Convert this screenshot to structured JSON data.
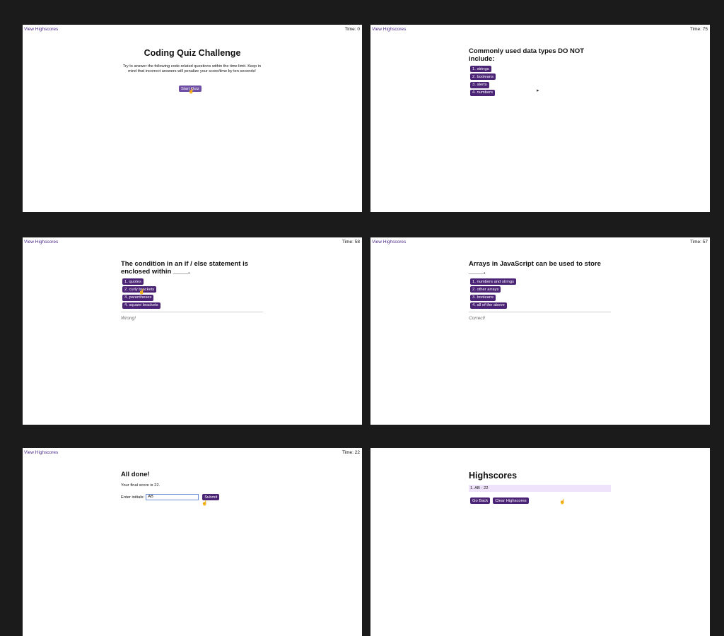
{
  "header": {
    "view_highscores": "View Highscores"
  },
  "screen1": {
    "timer": "Time: 0",
    "title": "Coding Quiz Challenge",
    "description": "Try to answer the following code-related questions within the time limit. Keep in mind that incorrect answers will penalize your score/time by ten seconds!",
    "start_button": "Start Quiz"
  },
  "screen2": {
    "timer": "Time: 75",
    "question": "Commonly used data types DO NOT include:",
    "answers": [
      "1. strings",
      "2. booleans",
      "3. alerts",
      "4. numbers"
    ]
  },
  "screen3": {
    "timer": "Time: 58",
    "question": "The condition in an if / else statement is enclosed within ____.",
    "answers": [
      "1. quotes",
      "2. curly brackets",
      "3. parentheses",
      "4. square brackets"
    ],
    "feedback": "Wrong!"
  },
  "screen4": {
    "timer": "Time: 57",
    "question": "Arrays in JavaScript can be used to store ____.",
    "answers": [
      "1. numbers and strings",
      "2. other arrays",
      "3. booleans",
      "4. all of the above"
    ],
    "feedback": "Correct!"
  },
  "screen5": {
    "timer": "Time: 22",
    "title": "All done!",
    "score_text": "Your final score is 22.",
    "initials_label": "Enter initials:",
    "initials_value": "AB",
    "submit_button": "Submit"
  },
  "screen6": {
    "title": "Highscores",
    "entries": [
      "1. AB - 22"
    ],
    "go_back_button": "Go Back",
    "clear_button": "Clear Highscores"
  },
  "colors": {
    "accent": "#4b2476",
    "start_button": "#6f4fa3",
    "highscore_row": "#eee3fa",
    "background": "#1b1b1b"
  }
}
